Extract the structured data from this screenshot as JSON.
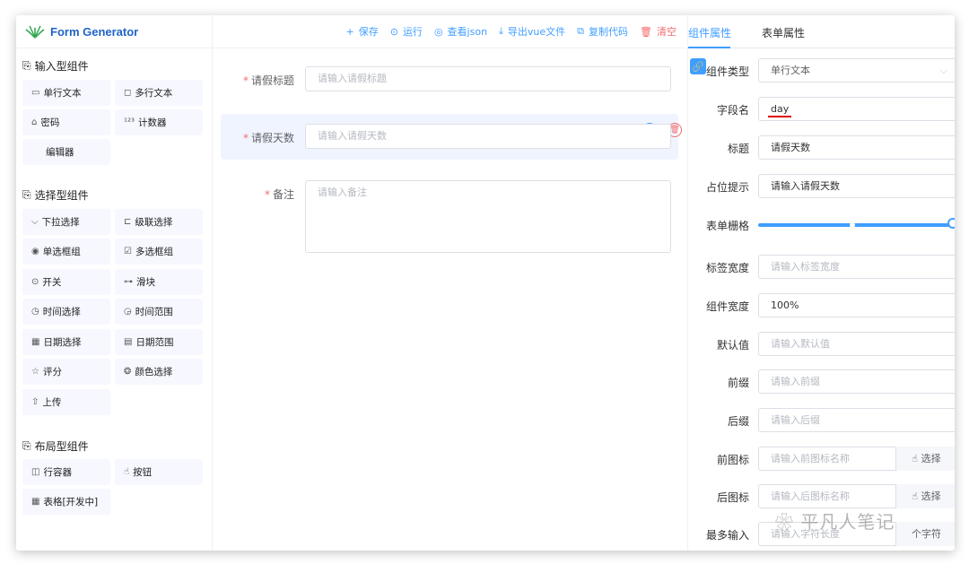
{
  "app": {
    "title": "Form Generator"
  },
  "left": {
    "groups": [
      {
        "title": "输入型组件",
        "items": [
          {
            "icon": "input-icon",
            "label": "单行文本"
          },
          {
            "icon": "textarea-icon",
            "label": "多行文本"
          },
          {
            "icon": "password-icon",
            "label": "密码"
          },
          {
            "icon": "number-icon",
            "label": "计数器"
          },
          {
            "icon": "",
            "label": "编辑器"
          }
        ]
      },
      {
        "title": "选择型组件",
        "items": [
          {
            "icon": "select-icon",
            "label": "下拉选择"
          },
          {
            "icon": "cascader-icon",
            "label": "级联选择"
          },
          {
            "icon": "radio-icon",
            "label": "单选框组"
          },
          {
            "icon": "checkbox-icon",
            "label": "多选框组"
          },
          {
            "icon": "switch-icon",
            "label": "开关"
          },
          {
            "icon": "slider-icon",
            "label": "滑块"
          },
          {
            "icon": "time-icon",
            "label": "时间选择"
          },
          {
            "icon": "time-range-icon",
            "label": "时间范围"
          },
          {
            "icon": "date-icon",
            "label": "日期选择"
          },
          {
            "icon": "date-range-icon",
            "label": "日期范围"
          },
          {
            "icon": "rate-icon",
            "label": "评分"
          },
          {
            "icon": "color-icon",
            "label": "颜色选择"
          },
          {
            "icon": "upload-icon",
            "label": "上传"
          }
        ]
      },
      {
        "title": "布局型组件",
        "items": [
          {
            "icon": "row-icon",
            "label": "行容器"
          },
          {
            "icon": "button-icon",
            "label": "按钮"
          },
          {
            "icon": "table-icon",
            "label": "表格[开发中]"
          }
        ]
      }
    ]
  },
  "toolbar": {
    "save": "保存",
    "run": "运行",
    "view_json": "查看json",
    "export_vue": "导出vue文件",
    "copy_code": "复制代码",
    "clear": "清空"
  },
  "form": {
    "fields": [
      {
        "label": "请假标题",
        "placeholder": "请输入请假标题",
        "required": true
      },
      {
        "label": "请假天数",
        "placeholder": "请输入请假天数",
        "required": true
      },
      {
        "label": "备注",
        "placeholder": "请输入备注",
        "required": true
      }
    ]
  },
  "right": {
    "tabs": [
      "组件属性",
      "表单属性"
    ],
    "props": [
      {
        "label": "组件类型",
        "value": "单行文本",
        "placeholder": ""
      },
      {
        "label": "字段名",
        "value": "day",
        "placeholder": ""
      },
      {
        "label": "标题",
        "value": "请假天数",
        "placeholder": ""
      },
      {
        "label": "占位提示",
        "value": "请输入请假天数",
        "placeholder": ""
      },
      {
        "label": "表单栅格",
        "value": "",
        "placeholder": ""
      },
      {
        "label": "标签宽度",
        "value": "",
        "placeholder": "请输入标签宽度"
      },
      {
        "label": "组件宽度",
        "value": "100%",
        "placeholder": ""
      },
      {
        "label": "默认值",
        "value": "",
        "placeholder": "请输入默认值"
      },
      {
        "label": "前缀",
        "value": "",
        "placeholder": "请输入前缀"
      },
      {
        "label": "后缀",
        "value": "",
        "placeholder": "请输入后缀"
      },
      {
        "label": "前图标",
        "value": "",
        "placeholder": "请输入前图标名称"
      },
      {
        "label": "后图标",
        "value": "",
        "placeholder": "请输入后图标名称"
      },
      {
        "label": "最多输入",
        "value": "",
        "placeholder": "请输入字符长度"
      }
    ],
    "select_label": "选择",
    "unit_label": "个字符",
    "grid_span_fraction": 1.0
  },
  "watermark": "平凡人笔记",
  "colors": {
    "accent": "#409eff",
    "danger": "#f56c6c",
    "brand": "#1f63c7"
  }
}
